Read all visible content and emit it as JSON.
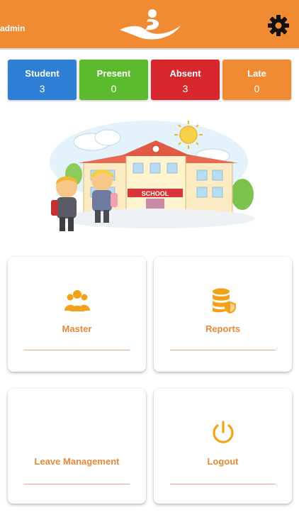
{
  "header": {
    "user": "admin",
    "logo_icon": "runner-logo-icon",
    "settings_icon": "gear-icon"
  },
  "stats": [
    {
      "label": "Student",
      "value": "3",
      "color": "#2f7fd6"
    },
    {
      "label": "Present",
      "value": "0",
      "color": "#5cba2f"
    },
    {
      "label": "Absent",
      "value": "3",
      "color": "#d6282c"
    },
    {
      "label": "Late",
      "value": "0",
      "color": "#f08b33"
    }
  ],
  "banner": {
    "school_sign": "SCHOOL"
  },
  "menu": [
    {
      "label": "Master",
      "icon": "users-group-icon"
    },
    {
      "label": "Reports",
      "icon": "database-shield-icon"
    },
    {
      "label": "Leave Management",
      "icon": ""
    },
    {
      "label": "Logout",
      "icon": "power-icon"
    }
  ],
  "colors": {
    "brand": "#f08b33",
    "label": "#e8893a",
    "divider": "#f2a08c"
  }
}
